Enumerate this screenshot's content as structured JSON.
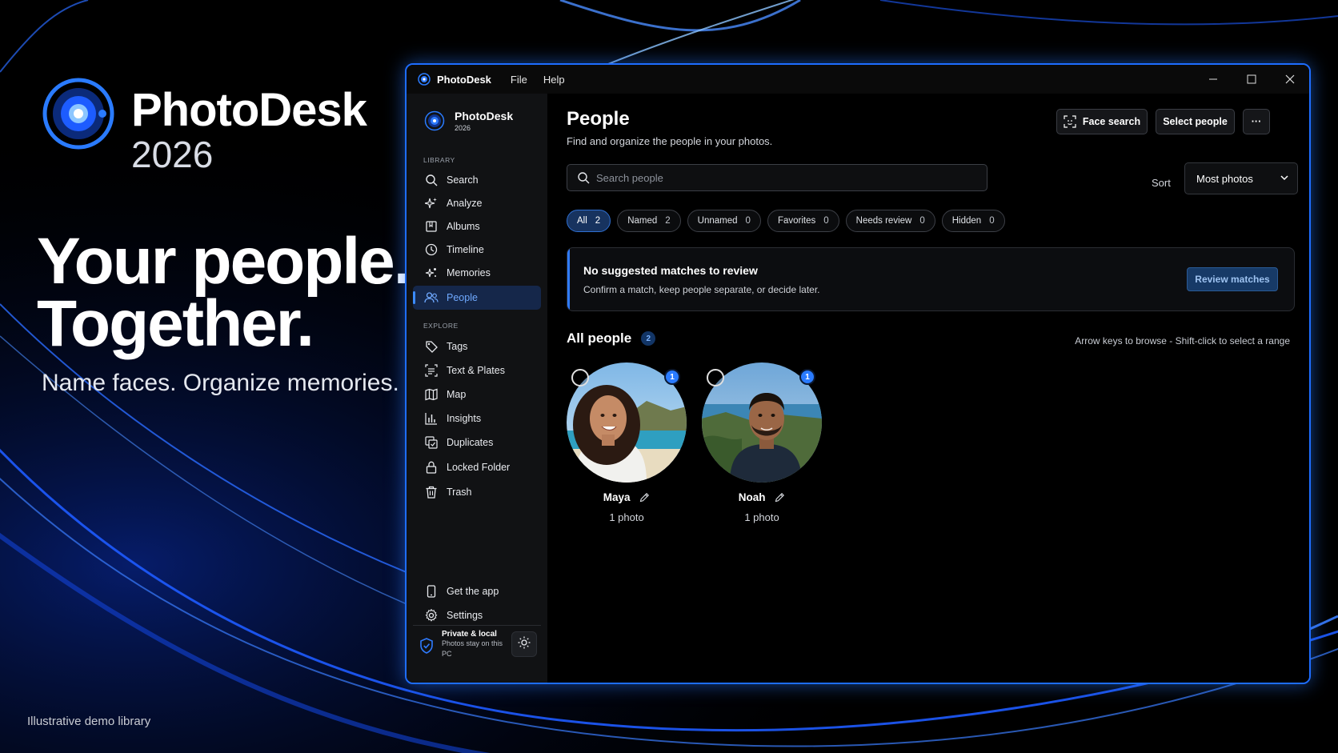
{
  "promo": {
    "brand": "PhotoDesk",
    "year": "2026",
    "headline_line1": "Your people.",
    "headline_line2": "Together.",
    "tagline": "Name faces. Organize memories.",
    "footnote": "Illustrative demo library"
  },
  "titlebar": {
    "app_name": "PhotoDesk",
    "menus": [
      "File",
      "Help"
    ],
    "controls": [
      "minimize-icon",
      "maximize-icon",
      "close-icon"
    ]
  },
  "sidebar": {
    "brand_name": "PhotoDesk",
    "brand_year": "2026",
    "library_label": "LIBRARY",
    "library_items": [
      {
        "label": "Search",
        "icon": "search-icon"
      },
      {
        "label": "Analyze",
        "icon": "sparkle-icon"
      },
      {
        "label": "Albums",
        "icon": "album-icon"
      },
      {
        "label": "Timeline",
        "icon": "clock-icon"
      },
      {
        "label": "Memories",
        "icon": "memories-sparkle-icon"
      },
      {
        "label": "People",
        "icon": "people-icon",
        "active": true
      }
    ],
    "explore_label": "EXPLORE",
    "explore_items": [
      {
        "label": "Tags",
        "icon": "tag-icon"
      },
      {
        "label": "Text & Plates",
        "icon": "text-scan-icon"
      },
      {
        "label": "Map",
        "icon": "map-icon"
      },
      {
        "label": "Insights",
        "icon": "chart-icon"
      },
      {
        "label": "Duplicates",
        "icon": "duplicates-icon"
      },
      {
        "label": "Locked Folder",
        "icon": "lock-icon"
      },
      {
        "label": "Trash",
        "icon": "trash-icon"
      }
    ],
    "footer_items": [
      {
        "label": "Get the app",
        "icon": "phone-icon"
      },
      {
        "label": "Settings",
        "icon": "gear-icon"
      }
    ],
    "privacy_title": "Private & local",
    "privacy_text": "Photos stay on this PC"
  },
  "main": {
    "title": "People",
    "subtitle": "Find and organize the people in your photos.",
    "face_search_label": "Face search",
    "select_people_label": "Select people",
    "more_label": "···",
    "search_placeholder": "Search people",
    "sort_label": "Sort",
    "sort_value": "Most photos",
    "filters": [
      {
        "label": "All",
        "count": "2",
        "active": true
      },
      {
        "label": "Named",
        "count": "2"
      },
      {
        "label": "Unnamed",
        "count": "0"
      },
      {
        "label": "Favorites",
        "count": "0"
      },
      {
        "label": "Needs review",
        "count": "0"
      },
      {
        "label": "Hidden",
        "count": "0"
      }
    ],
    "notice_title": "No suggested matches to review",
    "notice_text": "Confirm a match, keep people separate, or decide later.",
    "review_button": "Review matches",
    "all_people_label": "All people",
    "all_people_count": "2",
    "hint": "Arrow keys to browse - Shift-click to select a range",
    "people": [
      {
        "name": "Maya",
        "photos": "1 photo",
        "badge": "1"
      },
      {
        "name": "Noah",
        "photos": "1 photo",
        "badge": "1"
      }
    ]
  },
  "colors": {
    "accent": "#2f7bff",
    "window_border": "#1e6dff",
    "active_nav_bg": "#15274a",
    "active_nav_text": "#6fa9ff"
  }
}
